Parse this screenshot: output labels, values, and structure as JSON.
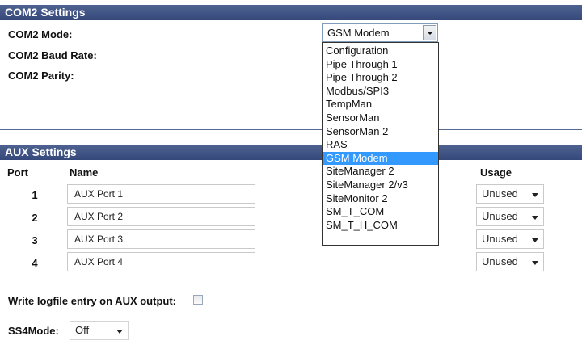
{
  "com2": {
    "header": "COM2 Settings",
    "mode_label": "COM2 Mode:",
    "baud_label": "COM2 Baud Rate:",
    "parity_label": "COM2 Parity:",
    "mode_value": "GSM Modem",
    "mode_options": [
      "Configuration",
      "Pipe Through 1",
      "Pipe Through 2",
      "Modbus/SPI3",
      "TempMan",
      "SensorMan",
      "SensorMan 2",
      "RAS",
      "GSM Modem",
      "SiteManager 2",
      "SiteManager 2/v3",
      "SiteMonitor 2",
      "SM_T_COM",
      "SM_T_H_COM"
    ],
    "selected_option_index": 8
  },
  "aux": {
    "header": "AUX Settings",
    "col_port": "Port",
    "col_name": "Name",
    "col_usage": "Usage",
    "rows": [
      {
        "port": "1",
        "name": "AUX Port 1",
        "usage": "Unused"
      },
      {
        "port": "2",
        "name": "AUX Port 2",
        "usage": "Unused"
      },
      {
        "port": "3",
        "name": "AUX Port 3",
        "usage": "Unused"
      },
      {
        "port": "4",
        "name": "AUX Port 4",
        "usage": "Unused"
      }
    ],
    "logfile_label": "Write logfile entry on AUX output:",
    "logfile_checked": false,
    "ss4_label": "SS4Mode:",
    "ss4_value": "Off"
  },
  "colors": {
    "header_bg": "#3f527f",
    "selected_option_bg": "#3399ff"
  },
  "icons": {
    "select_arrow": "chevron-down-icon",
    "checkbox": "checkbox-icon"
  }
}
